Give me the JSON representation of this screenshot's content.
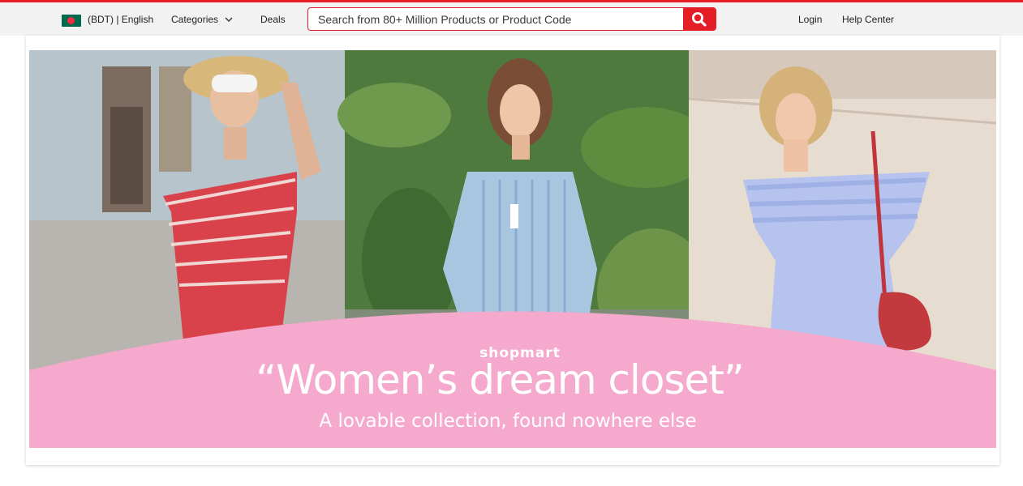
{
  "header": {
    "currency_language": "(BDT) | English",
    "categories_label": "Categories",
    "deals_label": "Deals",
    "login_label": "Login",
    "help_center_label": "Help Center",
    "flag_icon": "bangladesh-flag-icon"
  },
  "search": {
    "placeholder": "Search from 80+ Million Products or Product Code",
    "button_icon": "search-icon"
  },
  "banner": {
    "logo_text": "shopmart",
    "headline": "“Women’s dream closet”",
    "tagline": "A lovable collection, found nowhere else"
  },
  "colors": {
    "accent": "#e41e26",
    "banner_pink": "#f4a9cd",
    "header_bg": "#f2f2f2"
  }
}
